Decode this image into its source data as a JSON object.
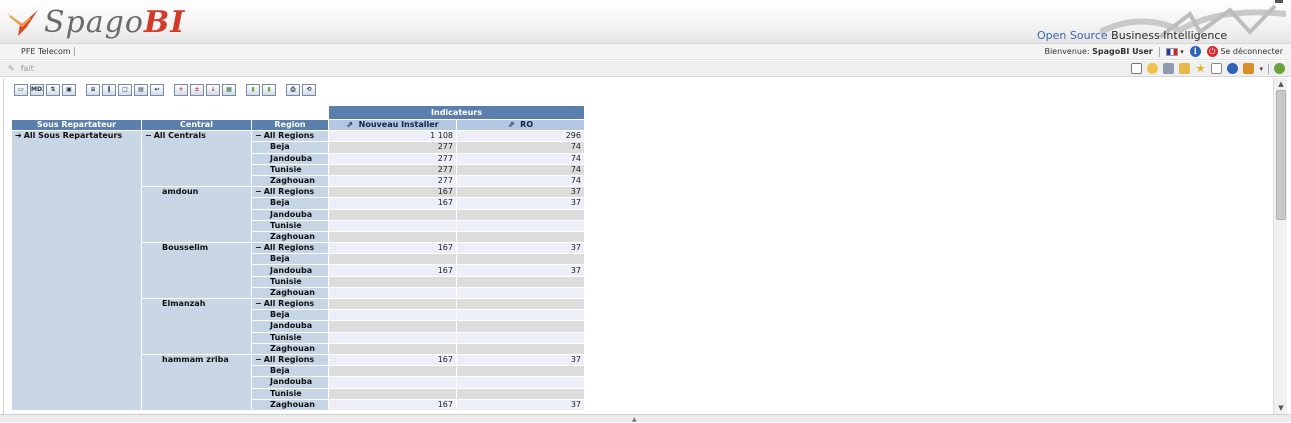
{
  "header": {
    "logo_text": "Spago",
    "logo_bi": "BI",
    "tagline_a": "Open Source",
    "tagline_b": "Business Intelligence"
  },
  "menubar": {
    "project": "PFE Telecom",
    "welcome_prefix": "Bienvenue:",
    "user": "SpagoBI User",
    "logout": "Se déconnecter"
  },
  "doc_toolbar": {
    "title": "fait"
  },
  "jpivot_toolbar": {
    "buttons": [
      "cube-navigator-icon",
      "mdx-editor-icon",
      "sort-icon",
      "save-icon",
      "hide-empty-rows-icon",
      "hide-empty-cols-icon",
      "swap-axes-icon",
      "show-parent-icon",
      "drill-replace-icon",
      "drill-member-icon",
      "drill-position-icon",
      "drill-through-icon",
      "chart-icon",
      "chart-config-icon",
      "print-icon",
      "excel-export-icon"
    ],
    "mdx_label": "MDX"
  },
  "pivot": {
    "indicateurs": "Indicateurs",
    "col_headers": [
      "Sous Repartateur",
      "Central",
      "Region"
    ],
    "measures": [
      "Nouveau Installer",
      "RO"
    ],
    "sous_repartateur": "All Sous Repartateurs",
    "groups": [
      {
        "central": "All Centrals",
        "rows": [
          {
            "region": "All Regions",
            "ni": "1 108",
            "ro": "296"
          },
          {
            "region": "Beja",
            "ni": "277",
            "ro": "74"
          },
          {
            "region": "Jandouba",
            "ni": "277",
            "ro": "74"
          },
          {
            "region": "Tunisie",
            "ni": "277",
            "ro": "74"
          },
          {
            "region": "Zaghouan",
            "ni": "277",
            "ro": "74"
          }
        ]
      },
      {
        "central": "amdoun",
        "rows": [
          {
            "region": "All Regions",
            "ni": "167",
            "ro": "37"
          },
          {
            "region": "Beja",
            "ni": "167",
            "ro": "37"
          },
          {
            "region": "Jandouba",
            "ni": "",
            "ro": ""
          },
          {
            "region": "Tunisie",
            "ni": "",
            "ro": ""
          },
          {
            "region": "Zaghouan",
            "ni": "",
            "ro": ""
          }
        ]
      },
      {
        "central": "Bousselim",
        "rows": [
          {
            "region": "All Regions",
            "ni": "167",
            "ro": "37"
          },
          {
            "region": "Beja",
            "ni": "",
            "ro": ""
          },
          {
            "region": "Jandouba",
            "ni": "167",
            "ro": "37"
          },
          {
            "region": "Tunisie",
            "ni": "",
            "ro": ""
          },
          {
            "region": "Zaghouan",
            "ni": "",
            "ro": ""
          }
        ]
      },
      {
        "central": "Elmanzah",
        "rows": [
          {
            "region": "All Regions",
            "ni": "",
            "ro": ""
          },
          {
            "region": "Beja",
            "ni": "",
            "ro": ""
          },
          {
            "region": "Jandouba",
            "ni": "",
            "ro": ""
          },
          {
            "region": "Tunisie",
            "ni": "",
            "ro": ""
          },
          {
            "region": "Zaghouan",
            "ni": "",
            "ro": ""
          }
        ]
      },
      {
        "central": "hammam zriba",
        "rows": [
          {
            "region": "All Regions",
            "ni": "167",
            "ro": "37"
          },
          {
            "region": "Beja",
            "ni": "",
            "ro": ""
          },
          {
            "region": "Jandouba",
            "ni": "",
            "ro": ""
          },
          {
            "region": "Tunisie",
            "ni": "",
            "ro": ""
          },
          {
            "region": "Zaghouan",
            "ni": "167",
            "ro": "37"
          }
        ]
      }
    ]
  }
}
